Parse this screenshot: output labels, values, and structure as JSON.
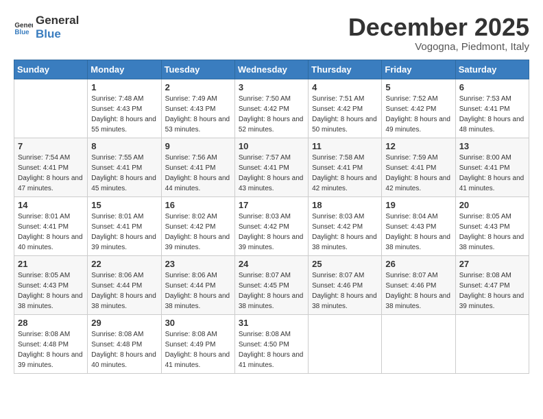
{
  "header": {
    "logo_general": "General",
    "logo_blue": "Blue",
    "month_title": "December 2025",
    "location": "Vogogna, Piedmont, Italy"
  },
  "weekdays": [
    "Sunday",
    "Monday",
    "Tuesday",
    "Wednesday",
    "Thursday",
    "Friday",
    "Saturday"
  ],
  "weeks": [
    [
      {
        "day": "",
        "sunrise": "",
        "sunset": "",
        "daylight": ""
      },
      {
        "day": "1",
        "sunrise": "Sunrise: 7:48 AM",
        "sunset": "Sunset: 4:43 PM",
        "daylight": "Daylight: 8 hours and 55 minutes."
      },
      {
        "day": "2",
        "sunrise": "Sunrise: 7:49 AM",
        "sunset": "Sunset: 4:43 PM",
        "daylight": "Daylight: 8 hours and 53 minutes."
      },
      {
        "day": "3",
        "sunrise": "Sunrise: 7:50 AM",
        "sunset": "Sunset: 4:42 PM",
        "daylight": "Daylight: 8 hours and 52 minutes."
      },
      {
        "day": "4",
        "sunrise": "Sunrise: 7:51 AM",
        "sunset": "Sunset: 4:42 PM",
        "daylight": "Daylight: 8 hours and 50 minutes."
      },
      {
        "day": "5",
        "sunrise": "Sunrise: 7:52 AM",
        "sunset": "Sunset: 4:42 PM",
        "daylight": "Daylight: 8 hours and 49 minutes."
      },
      {
        "day": "6",
        "sunrise": "Sunrise: 7:53 AM",
        "sunset": "Sunset: 4:41 PM",
        "daylight": "Daylight: 8 hours and 48 minutes."
      }
    ],
    [
      {
        "day": "7",
        "sunrise": "Sunrise: 7:54 AM",
        "sunset": "Sunset: 4:41 PM",
        "daylight": "Daylight: 8 hours and 47 minutes."
      },
      {
        "day": "8",
        "sunrise": "Sunrise: 7:55 AM",
        "sunset": "Sunset: 4:41 PM",
        "daylight": "Daylight: 8 hours and 45 minutes."
      },
      {
        "day": "9",
        "sunrise": "Sunrise: 7:56 AM",
        "sunset": "Sunset: 4:41 PM",
        "daylight": "Daylight: 8 hours and 44 minutes."
      },
      {
        "day": "10",
        "sunrise": "Sunrise: 7:57 AM",
        "sunset": "Sunset: 4:41 PM",
        "daylight": "Daylight: 8 hours and 43 minutes."
      },
      {
        "day": "11",
        "sunrise": "Sunrise: 7:58 AM",
        "sunset": "Sunset: 4:41 PM",
        "daylight": "Daylight: 8 hours and 42 minutes."
      },
      {
        "day": "12",
        "sunrise": "Sunrise: 7:59 AM",
        "sunset": "Sunset: 4:41 PM",
        "daylight": "Daylight: 8 hours and 42 minutes."
      },
      {
        "day": "13",
        "sunrise": "Sunrise: 8:00 AM",
        "sunset": "Sunset: 4:41 PM",
        "daylight": "Daylight: 8 hours and 41 minutes."
      }
    ],
    [
      {
        "day": "14",
        "sunrise": "Sunrise: 8:01 AM",
        "sunset": "Sunset: 4:41 PM",
        "daylight": "Daylight: 8 hours and 40 minutes."
      },
      {
        "day": "15",
        "sunrise": "Sunrise: 8:01 AM",
        "sunset": "Sunset: 4:41 PM",
        "daylight": "Daylight: 8 hours and 39 minutes."
      },
      {
        "day": "16",
        "sunrise": "Sunrise: 8:02 AM",
        "sunset": "Sunset: 4:42 PM",
        "daylight": "Daylight: 8 hours and 39 minutes."
      },
      {
        "day": "17",
        "sunrise": "Sunrise: 8:03 AM",
        "sunset": "Sunset: 4:42 PM",
        "daylight": "Daylight: 8 hours and 39 minutes."
      },
      {
        "day": "18",
        "sunrise": "Sunrise: 8:03 AM",
        "sunset": "Sunset: 4:42 PM",
        "daylight": "Daylight: 8 hours and 38 minutes."
      },
      {
        "day": "19",
        "sunrise": "Sunrise: 8:04 AM",
        "sunset": "Sunset: 4:43 PM",
        "daylight": "Daylight: 8 hours and 38 minutes."
      },
      {
        "day": "20",
        "sunrise": "Sunrise: 8:05 AM",
        "sunset": "Sunset: 4:43 PM",
        "daylight": "Daylight: 8 hours and 38 minutes."
      }
    ],
    [
      {
        "day": "21",
        "sunrise": "Sunrise: 8:05 AM",
        "sunset": "Sunset: 4:43 PM",
        "daylight": "Daylight: 8 hours and 38 minutes."
      },
      {
        "day": "22",
        "sunrise": "Sunrise: 8:06 AM",
        "sunset": "Sunset: 4:44 PM",
        "daylight": "Daylight: 8 hours and 38 minutes."
      },
      {
        "day": "23",
        "sunrise": "Sunrise: 8:06 AM",
        "sunset": "Sunset: 4:44 PM",
        "daylight": "Daylight: 8 hours and 38 minutes."
      },
      {
        "day": "24",
        "sunrise": "Sunrise: 8:07 AM",
        "sunset": "Sunset: 4:45 PM",
        "daylight": "Daylight: 8 hours and 38 minutes."
      },
      {
        "day": "25",
        "sunrise": "Sunrise: 8:07 AM",
        "sunset": "Sunset: 4:46 PM",
        "daylight": "Daylight: 8 hours and 38 minutes."
      },
      {
        "day": "26",
        "sunrise": "Sunrise: 8:07 AM",
        "sunset": "Sunset: 4:46 PM",
        "daylight": "Daylight: 8 hours and 38 minutes."
      },
      {
        "day": "27",
        "sunrise": "Sunrise: 8:08 AM",
        "sunset": "Sunset: 4:47 PM",
        "daylight": "Daylight: 8 hours and 39 minutes."
      }
    ],
    [
      {
        "day": "28",
        "sunrise": "Sunrise: 8:08 AM",
        "sunset": "Sunset: 4:48 PM",
        "daylight": "Daylight: 8 hours and 39 minutes."
      },
      {
        "day": "29",
        "sunrise": "Sunrise: 8:08 AM",
        "sunset": "Sunset: 4:48 PM",
        "daylight": "Daylight: 8 hours and 40 minutes."
      },
      {
        "day": "30",
        "sunrise": "Sunrise: 8:08 AM",
        "sunset": "Sunset: 4:49 PM",
        "daylight": "Daylight: 8 hours and 41 minutes."
      },
      {
        "day": "31",
        "sunrise": "Sunrise: 8:08 AM",
        "sunset": "Sunset: 4:50 PM",
        "daylight": "Daylight: 8 hours and 41 minutes."
      },
      {
        "day": "",
        "sunrise": "",
        "sunset": "",
        "daylight": ""
      },
      {
        "day": "",
        "sunrise": "",
        "sunset": "",
        "daylight": ""
      },
      {
        "day": "",
        "sunrise": "",
        "sunset": "",
        "daylight": ""
      }
    ]
  ]
}
